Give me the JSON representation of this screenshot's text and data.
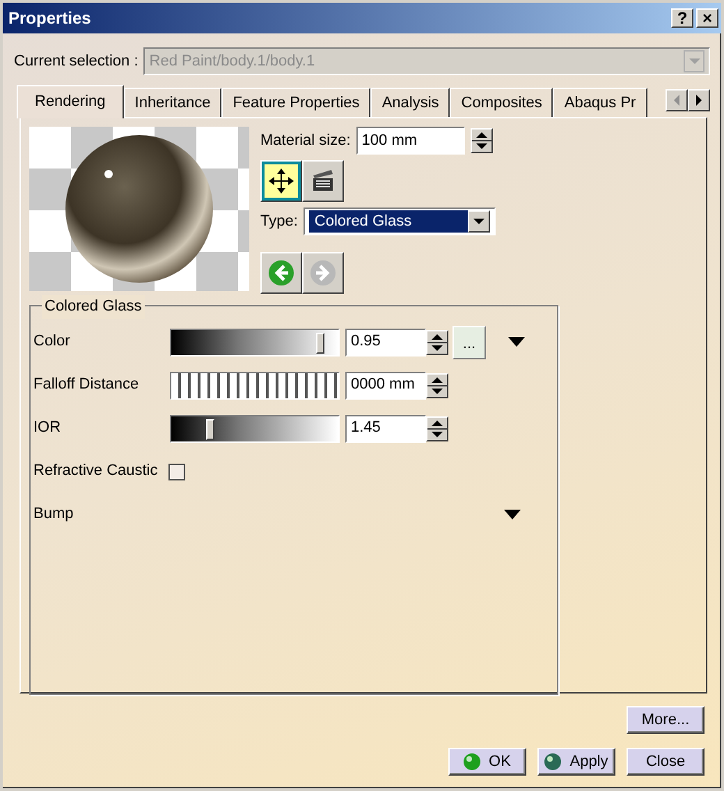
{
  "window": {
    "title": "Properties",
    "buttons": [
      "?",
      "×"
    ]
  },
  "current_selection": {
    "label": "Current selection :",
    "value": "Red Paint/body.1/body.1",
    "disabled": true
  },
  "tabs": [
    {
      "label": "Rendering",
      "selected": true
    },
    {
      "label": "Inheritance",
      "selected": false
    },
    {
      "label": "Feature Properties",
      "selected": false
    },
    {
      "label": "Analysis",
      "selected": false
    },
    {
      "label": "Composites",
      "selected": false
    },
    {
      "label": "Abaqus Pr",
      "selected": false
    }
  ],
  "tab_scroll": [
    {
      "kind": "left",
      "disabled": true
    },
    {
      "kind": "right",
      "disabled": false
    }
  ],
  "preview": {
    "material_size": {
      "label": "Material size:",
      "value": "100 mm"
    },
    "tools": [
      {
        "kind": "move",
        "selected": true
      },
      {
        "kind": "clapper",
        "selected": false
      }
    ],
    "type": {
      "label": "Type:",
      "value": "Colored Glass",
      "focused": true
    },
    "nav": [
      {
        "kind": "back",
        "disabled": false
      },
      {
        "kind": "forward",
        "disabled": true
      }
    ]
  },
  "group": {
    "title": "Colored Glass",
    "rows": [
      {
        "kind": "slider",
        "label": "Color",
        "level": 0.93,
        "value": "0.95",
        "button": "...",
        "expander": true
      },
      {
        "kind": "tick_slider",
        "label": "Falloff Distance",
        "value": "0000 mm"
      },
      {
        "kind": "slider",
        "label": "IOR",
        "level": 0.22,
        "value": "1.45"
      },
      {
        "kind": "checkbox",
        "label": "Refractive Caustic",
        "checked": false
      },
      {
        "kind": "expander",
        "label": "Bump"
      }
    ]
  },
  "more_button": "More...",
  "footer_buttons": [
    {
      "kind": "ok",
      "label": "OK"
    },
    {
      "kind": "apply",
      "label": "Apply"
    },
    {
      "kind": "plain",
      "label": "Close"
    }
  ]
}
